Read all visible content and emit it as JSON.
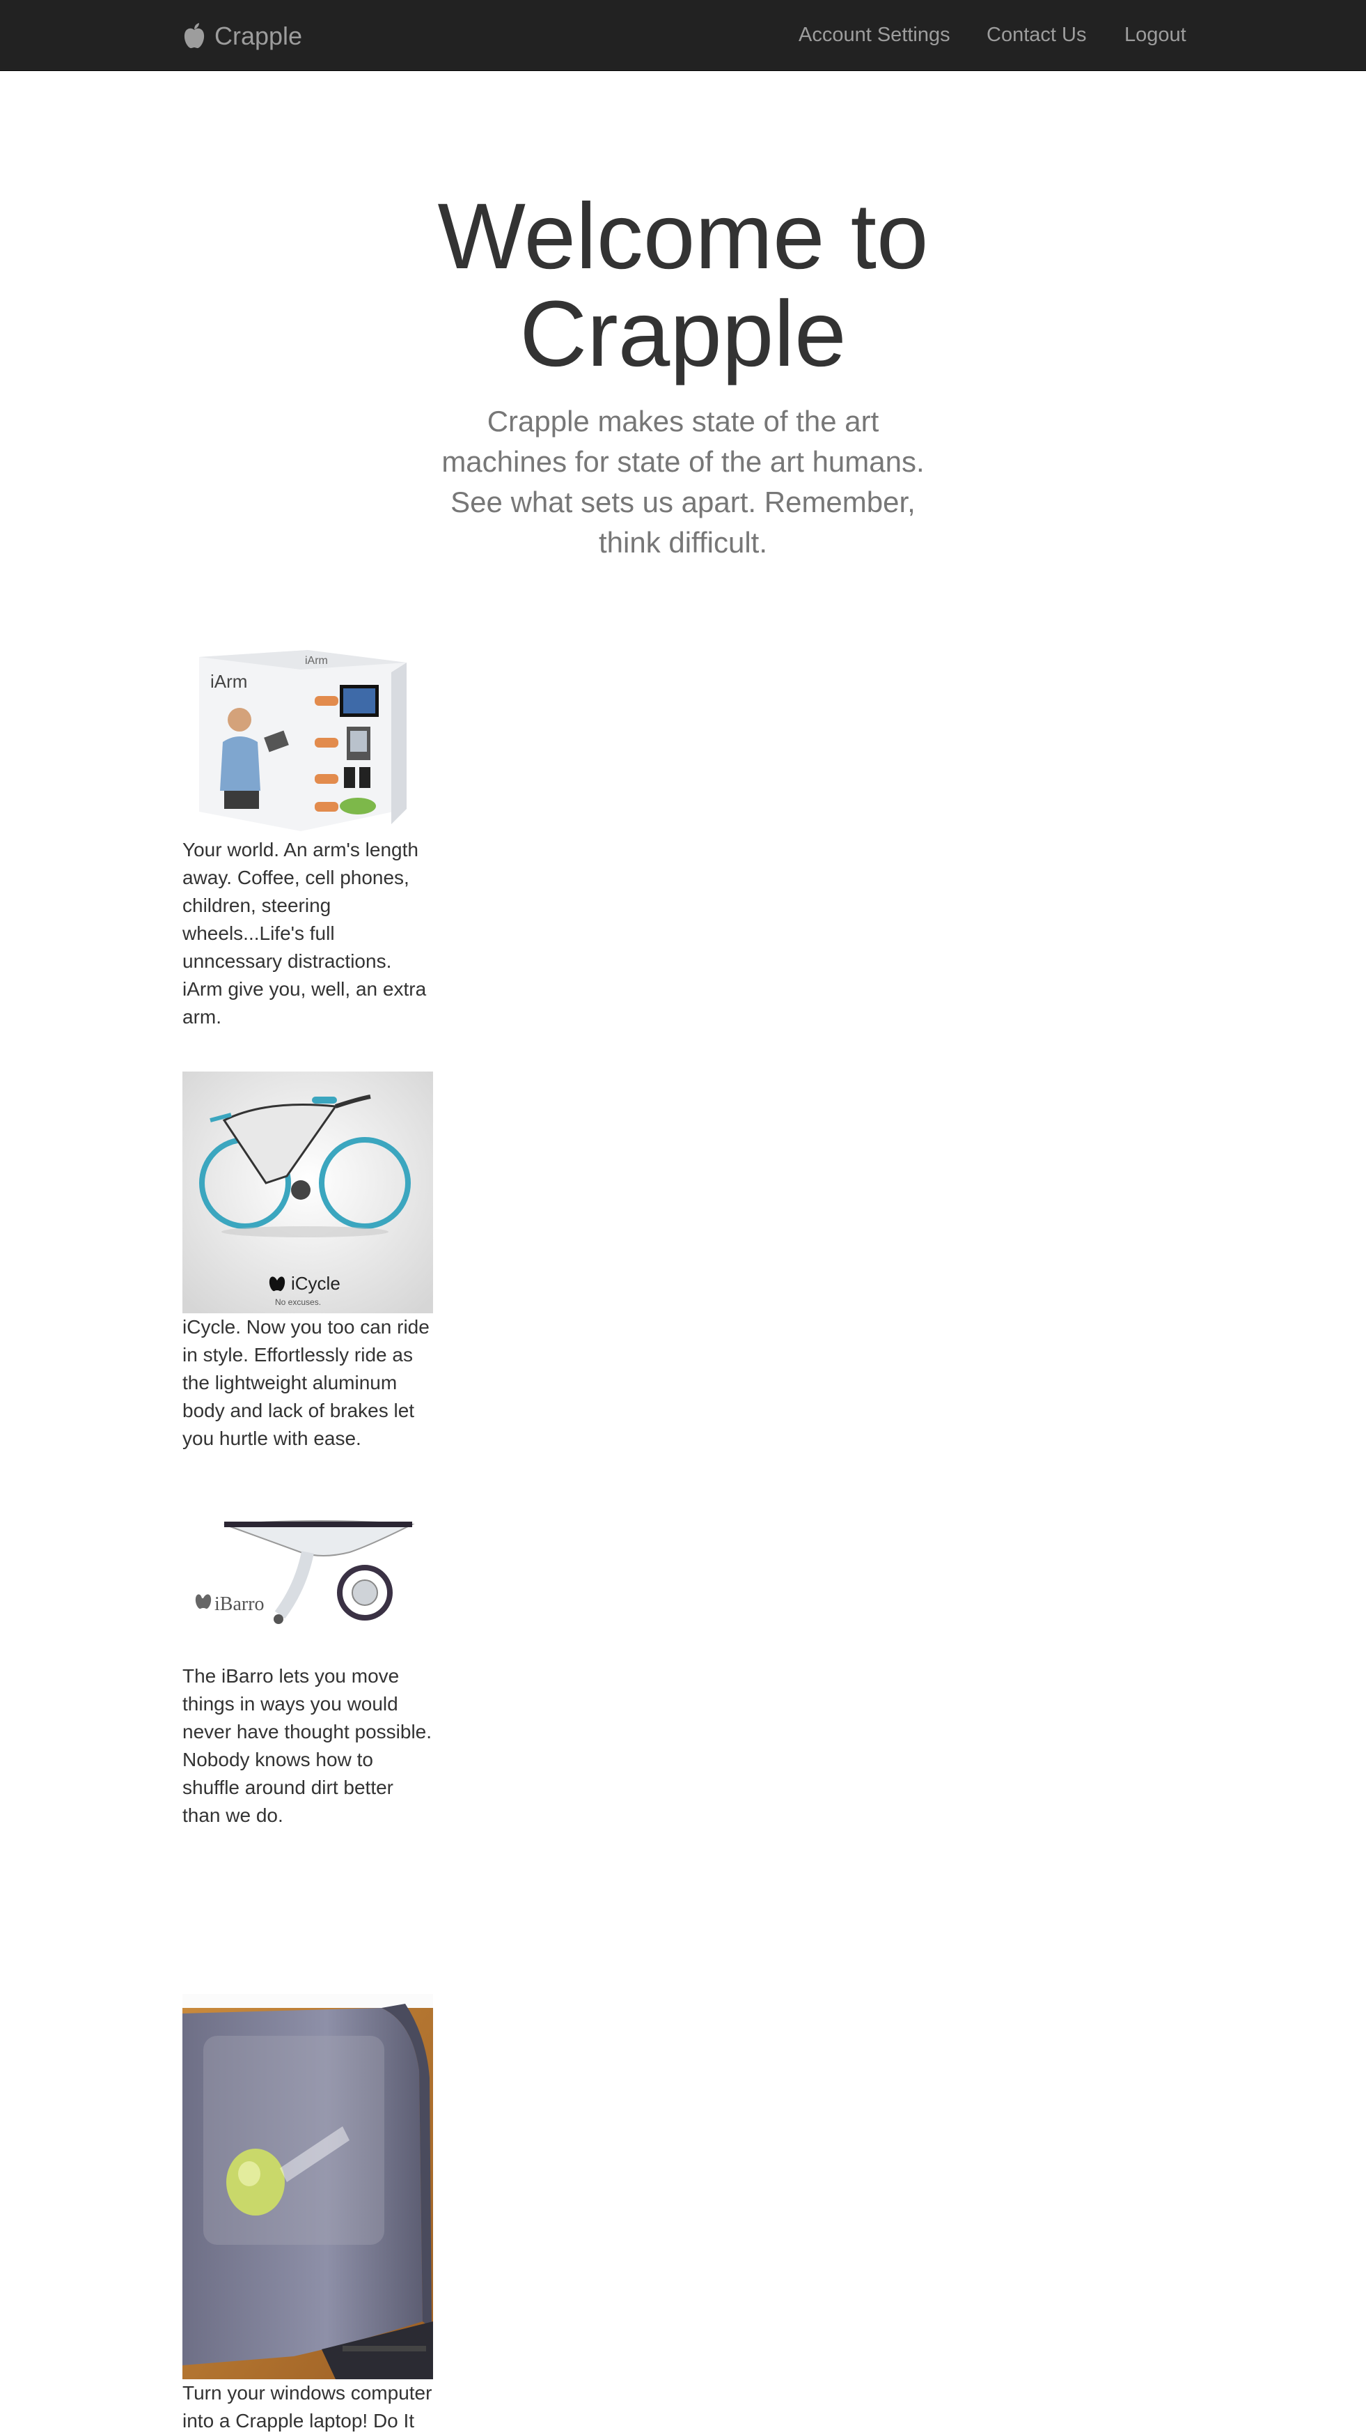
{
  "navbar": {
    "brand": {
      "icon": "apple-logo-icon",
      "label": "Crapple"
    },
    "links": [
      {
        "label": "Account Settings"
      },
      {
        "label": "Contact Us"
      },
      {
        "label": "Logout"
      }
    ]
  },
  "hero": {
    "title": "Welcome to Crapple",
    "lead": "Crapple makes state of the art machines for state of the art humans. See what sets us apart. Remember, think difficult."
  },
  "products": [
    {
      "image_name": "iarm-product-image",
      "description": "Your world. An arm's length away. Coffee, cell phones, children, steering wheels...Life's full unncessary distractions. iArm give you, well, an extra arm."
    },
    {
      "image_name": "icycle-product-image",
      "description": "iCycle. Now you too can ride in style. Effortlessly ride as the lightweight aluminum body and lack of brakes let you hurtle with ease."
    },
    {
      "image_name": "ibarro-product-image",
      "description": "The iBarro lets you move things in ways you would never have thought possible. Nobody knows how to shuffle around dirt better than we do."
    },
    {
      "image_name": "crapple-laptop-product-image",
      "description": "Turn your windows computer into a Crapple laptop! Do It"
    }
  ],
  "image_text": {
    "iarm_box_brand": "iArm",
    "icycle_brand": "iCycle",
    "icycle_tagline": "No excuses.",
    "ibarro_brand": "iBarro"
  },
  "colors": {
    "navbar_bg": "#222222",
    "nav_text": "#9d9d9d",
    "heading": "#333333",
    "lead": "#777777"
  }
}
